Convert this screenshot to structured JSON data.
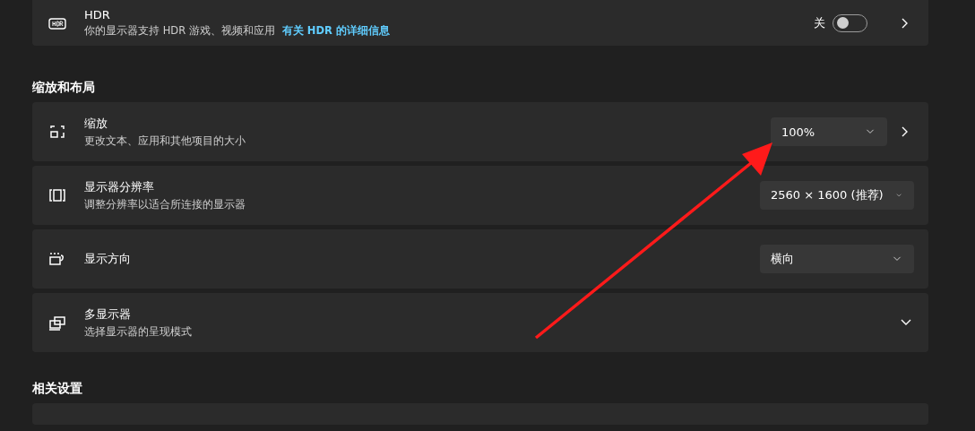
{
  "hdr": {
    "title": "HDR",
    "description": "你的显示器支持 HDR 游戏、视频和应用",
    "link": "有关 HDR 的详细信息",
    "toggle_label": "关",
    "on": false
  },
  "sections": [
    {
      "heading": "缩放和布局",
      "items": [
        {
          "kind": "dropdown",
          "title": "缩放",
          "description": "更改文本、应用和其他项目的大小",
          "value": "100%",
          "more": true
        },
        {
          "kind": "dropdown",
          "title": "显示器分辨率",
          "description": "调整分辨率以适合所连接的显示器",
          "value": "2560 × 1600 (推荐)",
          "more": false
        },
        {
          "kind": "dropdown",
          "title": "显示方向",
          "value": "横向",
          "more": false
        },
        {
          "kind": "expander",
          "title": "多显示器",
          "description": "选择显示器的呈现模式",
          "expanded": false
        }
      ]
    },
    {
      "heading": "相关设置",
      "items": [
        {
          "kind": "cut"
        }
      ]
    }
  ]
}
